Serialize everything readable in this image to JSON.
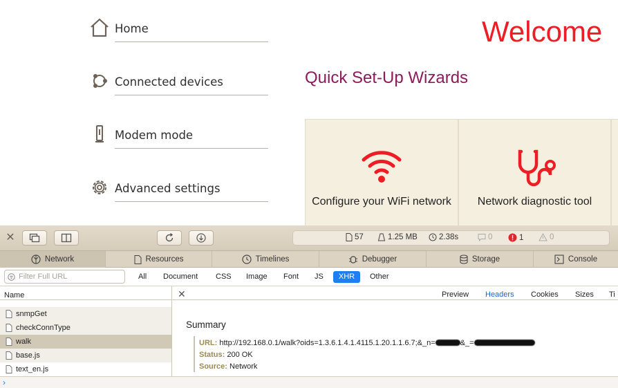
{
  "nav": {
    "home": "Home",
    "connected_devices": "Connected devices",
    "modem_mode": "Modem mode",
    "advanced_settings": "Advanced settings"
  },
  "welcome": "Welcome",
  "wizards": {
    "title": "Quick Set-Up Wizards",
    "cards": [
      {
        "label": "Configure your WiFi network",
        "icon": "wifi-icon"
      },
      {
        "label": "Network diagnostic tool",
        "icon": "stethoscope-icon"
      }
    ]
  },
  "inspector": {
    "stats": {
      "resources": "57",
      "size": "1.25 MB",
      "time": "2.38s",
      "logs": "0",
      "errors": "1",
      "warnings": "0"
    },
    "tabs": [
      "Network",
      "Resources",
      "Timelines",
      "Debugger",
      "Storage",
      "Console"
    ],
    "filter": {
      "placeholder": "Filter Full URL",
      "types": [
        "All",
        "Document",
        "CSS",
        "Image",
        "Font",
        "JS",
        "XHR",
        "Other"
      ],
      "active": "XHR"
    },
    "list": {
      "header": "Name",
      "rows": [
        "snmpGet",
        "checkConnType",
        "walk",
        "base.js",
        "text_en.js"
      ],
      "selected": "walk"
    },
    "detail_tabs": [
      "Preview",
      "Headers",
      "Cookies",
      "Sizes",
      "Ti"
    ],
    "detail_active": "Headers",
    "summary": {
      "title": "Summary",
      "url_label": "URL:",
      "url_value": "http://192.168.0.1/walk?oids=1.3.6.1.4.1.4115.1.20.1.1.6.7;&_n=",
      "url_mid": "&_=",
      "status_label": "Status:",
      "status_value": "200 OK",
      "source_label": "Source:",
      "source_value": "Network"
    }
  },
  "colors": {
    "brand_red": "#ee1c24",
    "wizard_title": "#8c1b5c",
    "active_blue": "#1f7ff2"
  }
}
